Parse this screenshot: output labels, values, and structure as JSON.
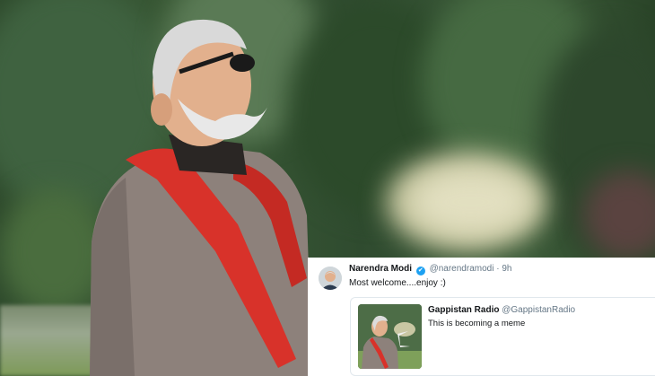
{
  "tweet": {
    "author_name": "Narendra Modi",
    "verified_mark": "✔",
    "handle": "@narendramodi",
    "separator": "·",
    "time": "9h",
    "text": "Most welcome....enjoy :)"
  },
  "quoted_tweet": {
    "author_name": "Gappistan Radio",
    "handle": "@GappistanRadio",
    "text": "This is becoming a meme"
  },
  "colors": {
    "verified_blue": "#1da1f2",
    "scarf_red": "#d8322a",
    "jacket_taupe": "#8d817b"
  },
  "icons": {
    "verified": "verified-badge-icon"
  }
}
